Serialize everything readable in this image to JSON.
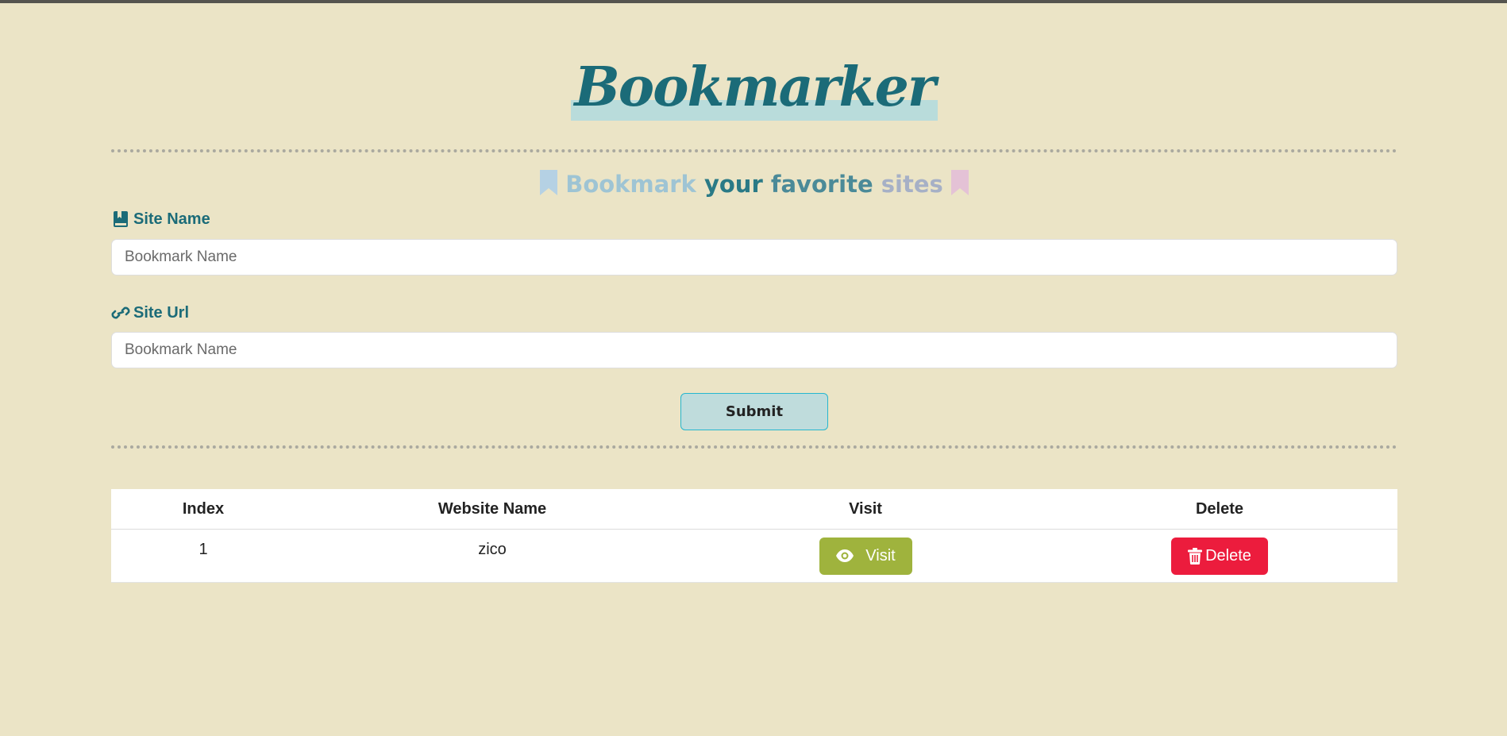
{
  "app": {
    "title": "Bookmarker"
  },
  "subtitle": {
    "words": [
      "Bookmark",
      "your",
      "favorite",
      "sites"
    ]
  },
  "form": {
    "site_name_label": "Site Name",
    "site_name_placeholder": "Bookmark Name",
    "site_name_value": "",
    "site_url_label": "Site Url",
    "site_url_placeholder": "Bookmark Name",
    "site_url_value": "",
    "submit_label": "Submit"
  },
  "table": {
    "headers": {
      "index": "Index",
      "name": "Website Name",
      "visit": "Visit",
      "delete": "Delete"
    },
    "rows": [
      {
        "index": "1",
        "name": "zico",
        "visit_label": "Visit",
        "delete_label": "Delete"
      }
    ]
  },
  "icons": {
    "title_highlight": "marker-highlight",
    "subtitle_left": "bookmark-icon",
    "subtitle_right": "bookmark-icon",
    "site_name": "book-bookmark-icon",
    "site_url": "link-icon",
    "visit": "eye-icon",
    "delete": "trash-icon"
  },
  "colors": {
    "background": "#ebe4c6",
    "primary": "#1b6b78",
    "title_highlight": "#b9dcdb",
    "submit_bg": "#bfdcdc",
    "submit_border": "#26b6cf",
    "visit_button": "#9fb33d",
    "delete_button": "#ec1c3d",
    "bookmark_left": "#b5d1e4",
    "bookmark_right": "#e4c2d6"
  }
}
